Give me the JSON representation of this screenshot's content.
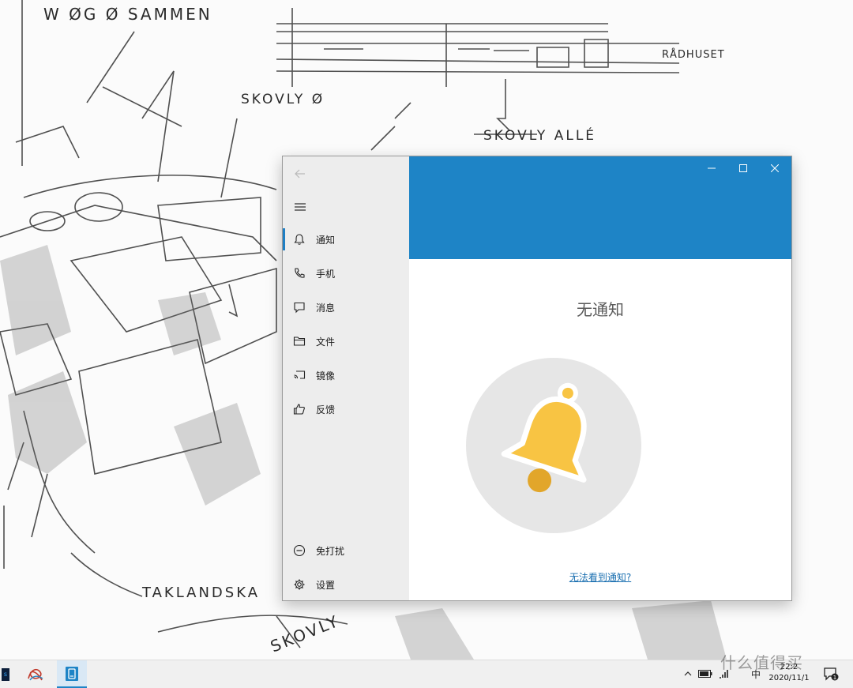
{
  "background": {
    "sketch_labels": [
      "W ØG Ø SAMMEN",
      "SKOVLY Ø",
      "SKOVLY ALLÉ",
      "RÅDHUSET",
      "TAKLANDSKA",
      "SKOVLY"
    ]
  },
  "window": {
    "accent_color": "#1e84c6",
    "nav": {
      "items": [
        {
          "label": "通知",
          "icon": "bell-icon",
          "selected": true
        },
        {
          "label": "手机",
          "icon": "phone-icon",
          "selected": false
        },
        {
          "label": "消息",
          "icon": "message-icon",
          "selected": false
        },
        {
          "label": "文件",
          "icon": "folder-icon",
          "selected": false
        },
        {
          "label": "镜像",
          "icon": "cast-icon",
          "selected": false
        },
        {
          "label": "反馈",
          "icon": "thumbs-up-icon",
          "selected": false
        }
      ],
      "bottom_items": [
        {
          "label": "免打扰",
          "icon": "do-not-disturb-icon"
        },
        {
          "label": "设置",
          "icon": "gear-icon"
        }
      ]
    },
    "content": {
      "title": "无通知",
      "help_link": "无法看到通知?"
    }
  },
  "taskbar": {
    "clock_time": "22:2",
    "clock_date": "2020/11/1",
    "ime_label": "中",
    "watermark": "什么值得买"
  }
}
